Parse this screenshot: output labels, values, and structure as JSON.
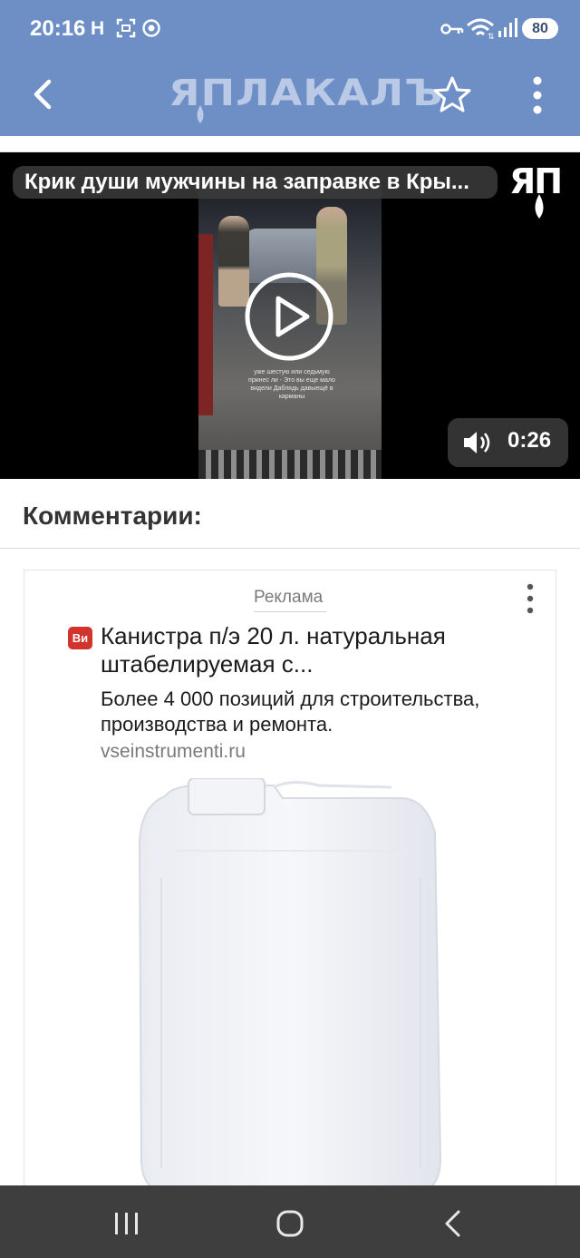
{
  "status_bar": {
    "time": "20:16",
    "notif_h": "H",
    "battery": "80"
  },
  "app_bar": {
    "logo_text": "ЯПЛАКАЛЪ",
    "back_icon": "back-arrow-icon",
    "star_icon": "star-outline-icon",
    "menu_icon": "more-vert-icon"
  },
  "video": {
    "title": "Крик души мужчины на заправке в Кры...",
    "watermark": "ЯП",
    "caption": "уже шестую или седьмую принес ли - Это вы еще мало видели Даблядь давыещё в карманы",
    "duration": "0:26",
    "colors": {
      "accent": "#6e8fc6",
      "overlay": "#3c3c3c"
    }
  },
  "comments": {
    "title": "Комментарии:"
  },
  "ad": {
    "label": "Реклама",
    "badge": "Ви",
    "headline": "Канистра п/э 20 л. натуральная штабелируемая с...",
    "description": "Более 4 000 позиций для строительства, производства и ремонта.",
    "domain": "vseinstrumenti.ru",
    "badge_color": "#d2332d"
  },
  "nav_bar": {
    "recent_icon": "recent-apps-icon",
    "home_icon": "home-icon",
    "back_icon": "nav-back-icon"
  }
}
